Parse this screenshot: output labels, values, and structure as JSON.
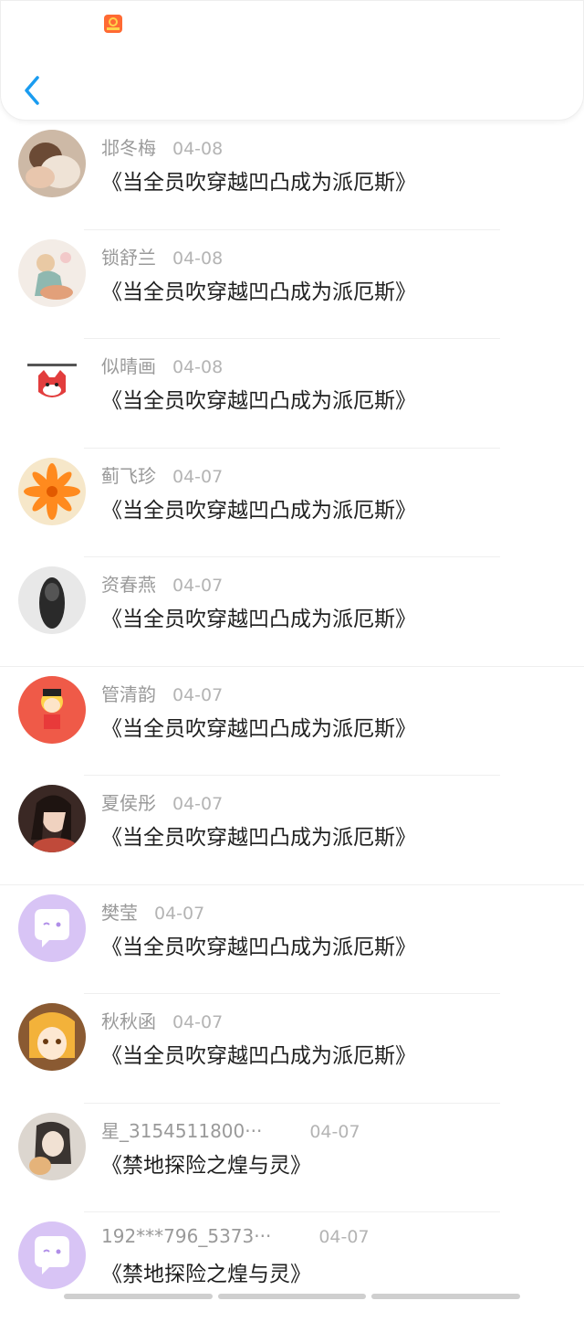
{
  "header": {
    "app_icon": "app-badge-icon",
    "back_icon": "back-chevron-icon",
    "accent": "#1a9cf0"
  },
  "comments": [
    {
      "name": "邶冬梅",
      "date": "04-08",
      "title": "《当全员吹穿越凹凸成为派厄斯》",
      "avatar": "photo-person"
    },
    {
      "name": "锁舒兰",
      "date": "04-08",
      "title": "《当全员吹穿越凹凸成为派厄斯》",
      "avatar": "illustration-girl"
    },
    {
      "name": "似晴画",
      "date": "04-08",
      "title": "《当全员吹穿越凹凸成为派厄斯》",
      "avatar": "cartoon-fox"
    },
    {
      "name": "蓟飞珍",
      "date": "04-07",
      "title": "《当全员吹穿越凹凸成为派厄斯》",
      "avatar": "orange-flower"
    },
    {
      "name": "资春燕",
      "date": "04-07",
      "title": "《当全员吹穿越凹凸成为派厄斯》",
      "avatar": "dark-figure"
    },
    {
      "name": "管清韵",
      "date": "04-07",
      "title": "《当全员吹穿越凹凸成为派厄斯》",
      "avatar": "cartoon-girl-red"
    },
    {
      "name": "夏侯彤",
      "date": "04-07",
      "title": "《当全员吹穿越凹凸成为派厄斯》",
      "avatar": "photo-woman"
    },
    {
      "name": "樊莹",
      "date": "04-07",
      "title": "《当全员吹穿越凹凸成为派厄斯》",
      "avatar": "default-chat"
    },
    {
      "name": "秋秋函",
      "date": "04-07",
      "title": "《当全员吹穿越凹凸成为派厄斯》",
      "avatar": "anime-girl"
    },
    {
      "name": "星_3154511800···",
      "date": "04-07",
      "title": "《禁地探险之煌与灵》",
      "avatar": "anime-cat-girl"
    },
    {
      "name": "192***796_5373···",
      "date": "04-07",
      "title": "《禁地探险之煌与灵》",
      "avatar": "default-chat"
    }
  ]
}
